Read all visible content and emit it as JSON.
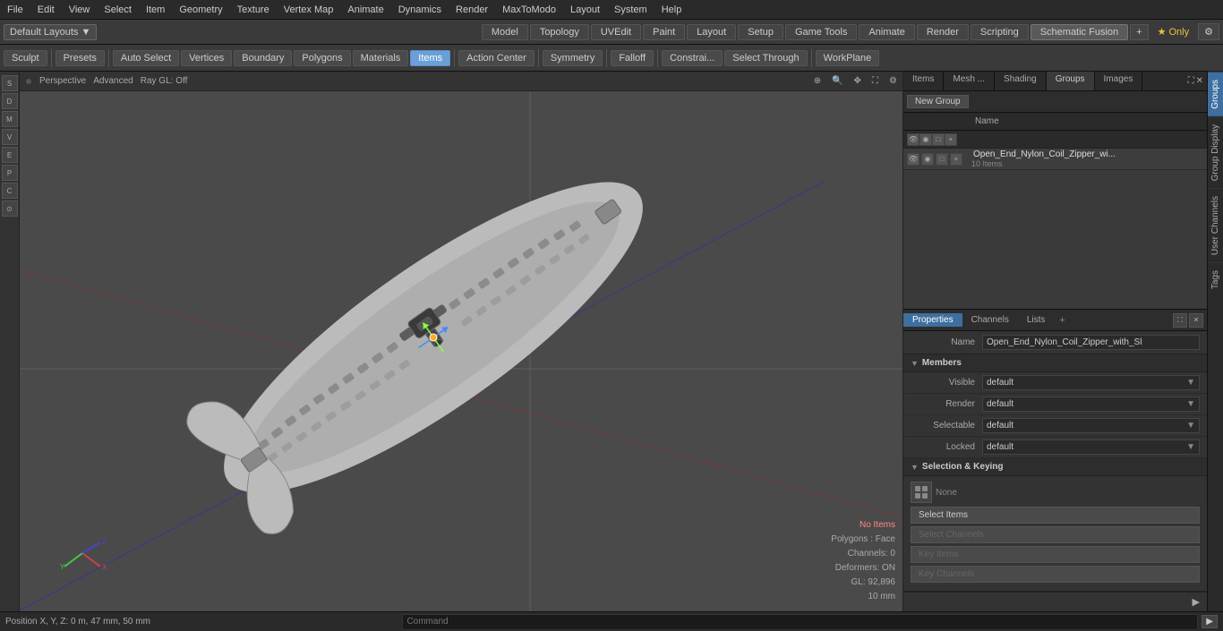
{
  "menubar": {
    "items": [
      "File",
      "Edit",
      "View",
      "Select",
      "Item",
      "Geometry",
      "Texture",
      "Vertex Map",
      "Animate",
      "Dynamics",
      "Render",
      "MaxToModo",
      "Layout",
      "System",
      "Help"
    ]
  },
  "layout": {
    "dropdown": "Default Layouts ▼",
    "tabs": [
      "Model",
      "Topology",
      "UVEdit",
      "Paint",
      "Layout",
      "Setup",
      "Game Tools",
      "Animate",
      "Render",
      "Scripting",
      "Schematic Fusion"
    ],
    "add_tab": "+",
    "star_only": "★ Only",
    "settings_icon": "⚙"
  },
  "toolbar": {
    "sculpt_label": "Sculpt",
    "presets_label": "Presets",
    "auto_select_label": "Auto Select",
    "vertices_label": "Vertices",
    "boundary_label": "Boundary",
    "polygons_label": "Polygons",
    "materials_label": "Materials",
    "items_label": "Items",
    "action_center_label": "Action Center",
    "symmetry_label": "Symmetry",
    "falloff_label": "Falloff",
    "constraints_label": "Constrai...",
    "select_through_label": "Select Through",
    "workplane_label": "WorkPlane"
  },
  "viewport": {
    "dot_label": "●",
    "view_label": "Perspective",
    "advanced_label": "Advanced",
    "ray_gl_label": "Ray GL: Off",
    "no_items_label": "No Items",
    "polygons_label": "Polygons : Face",
    "channels_label": "Channels: 0",
    "deformers_label": "Deformers: ON",
    "gl_label": "GL: 92,896",
    "mm_label": "10 mm"
  },
  "right_panel": {
    "tabs": [
      "Items",
      "Mesh ...",
      "Shading",
      "Groups",
      "Images"
    ],
    "active_tab": "Groups",
    "new_group_label": "New Group",
    "col_name": "Name",
    "group_name": "Open_End_Nylon_Coil_Zipper_wi...",
    "group_count": "10 Items"
  },
  "properties": {
    "tabs": [
      "Properties",
      "Channels",
      "Lists"
    ],
    "active_tab": "Properties",
    "add_tab": "+",
    "name_label": "Name",
    "name_value": "Open_End_Nylon_Coil_Zipper_with_Sl",
    "members_label": "Members",
    "visible_label": "Visible",
    "visible_value": "default",
    "render_label": "Render",
    "render_value": "default",
    "selectable_label": "Selectable",
    "selectable_value": "default",
    "locked_label": "Locked",
    "locked_value": "default",
    "sel_key_label": "Selection & Keying",
    "none_label": "None",
    "select_items_label": "Select Items",
    "select_channels_label": "Select Channels",
    "key_items_label": "Key Items",
    "key_channels_label": "Key Channels"
  },
  "right_sidebar_tabs": [
    "Groups",
    "Group Display",
    "User Channels",
    "Tags"
  ],
  "status_bar": {
    "position_label": "Position X, Y, Z:",
    "position_value": "0 m, 47 mm, 50 mm",
    "command_placeholder": "Command",
    "exec_label": "▶"
  }
}
